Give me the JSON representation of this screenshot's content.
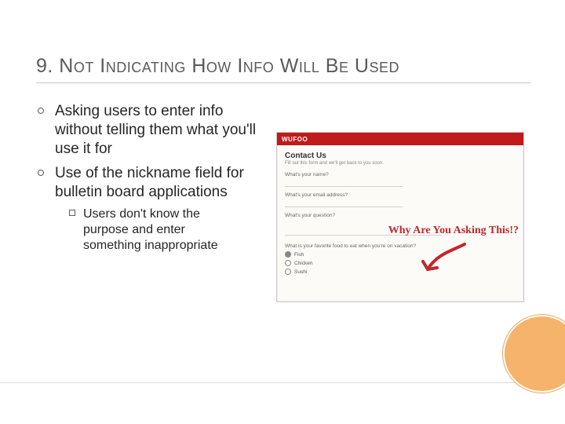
{
  "title": "9. Not Indicating How Info Will Be Used",
  "bullets": [
    {
      "text": "Asking users to enter info without telling them what you'll use it for"
    },
    {
      "text": "Use of the nickname field for bulletin board applications",
      "sub": [
        "Users don't know the purpose and enter something inappropriate"
      ]
    }
  ],
  "mock": {
    "brand": "WUFOO",
    "heading": "Contact Us",
    "subheading": "Fill out this form and we'll get back to you soon.",
    "labels": {
      "name": "What's your name?",
      "email": "What's your email address?",
      "question": "What's your question?"
    },
    "question": "What is your favorite food to eat when you're on vacation?",
    "options": [
      "Fish",
      "Chicken",
      "Sushi"
    ]
  },
  "annotation": "Why Are You Asking This!?"
}
